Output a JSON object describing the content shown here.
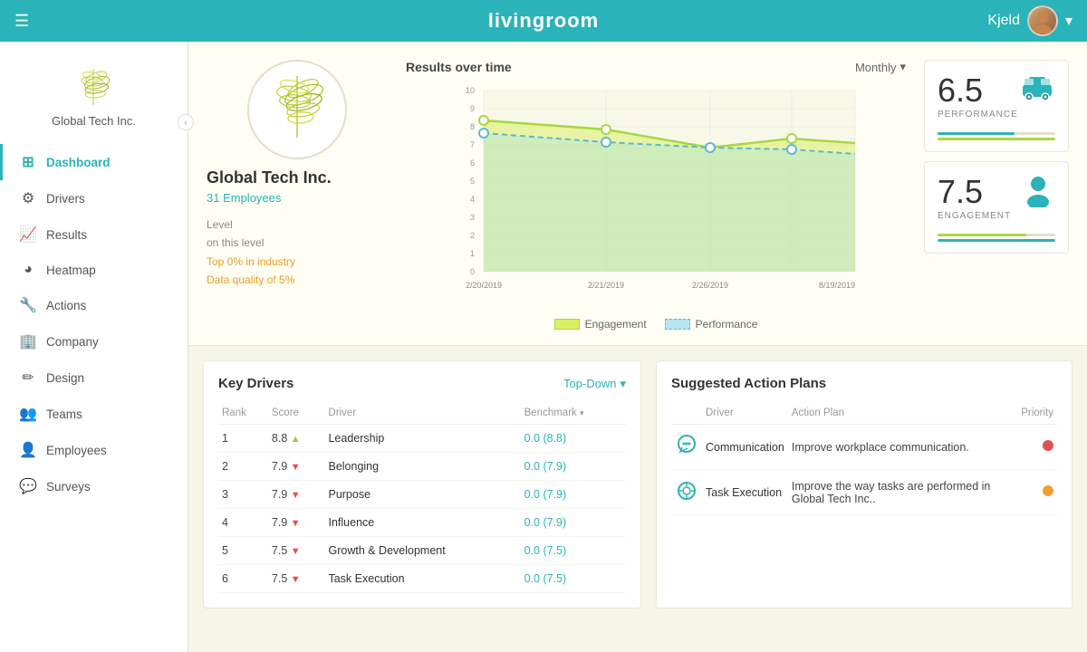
{
  "app": {
    "title": "livingroom"
  },
  "topbar": {
    "user_name": "Kjeld",
    "dropdown_arrow": "▾"
  },
  "sidebar": {
    "company_name": "Global Tech Inc.",
    "collapse_icon": "‹",
    "nav_items": [
      {
        "id": "dashboard",
        "label": "Dashboard",
        "icon": "⊞",
        "active": true
      },
      {
        "id": "drivers",
        "label": "Drivers",
        "icon": "⚙",
        "active": false
      },
      {
        "id": "results",
        "label": "Results",
        "icon": "📈",
        "active": false
      },
      {
        "id": "heatmap",
        "label": "Heatmap",
        "icon": "◕",
        "active": false
      },
      {
        "id": "actions",
        "label": "Actions",
        "icon": "🔧",
        "active": false
      },
      {
        "id": "company",
        "label": "Company",
        "icon": "🏢",
        "active": false
      },
      {
        "id": "design",
        "label": "Design",
        "icon": "👤",
        "active": false
      },
      {
        "id": "teams",
        "label": "Teams",
        "icon": "👥",
        "active": false
      },
      {
        "id": "employees",
        "label": "Employees",
        "icon": "👤",
        "active": false
      },
      {
        "id": "surveys",
        "label": "Surveys",
        "icon": "💬",
        "active": false
      }
    ]
  },
  "company_info": {
    "name": "Global Tech Inc.",
    "employees": "31 Employees",
    "level_label": "Level",
    "on_this_level": "on this level",
    "top_industry": "Top 0% in industry",
    "data_quality": "Data quality of 5%"
  },
  "chart": {
    "title_plain": "Results ",
    "title_bold": "over time",
    "period_selector": "Monthly",
    "legend_engagement": "Engagement",
    "legend_performance": "Performance",
    "x_labels": [
      "2/20/2019",
      "2/21/2019",
      "2/26/2019",
      "8/19/2019"
    ],
    "y_labels": [
      "0",
      "1",
      "2",
      "3",
      "4",
      "5",
      "6",
      "7",
      "8",
      "9",
      "10"
    ]
  },
  "scores": {
    "performance": {
      "value": "6.5",
      "label": "PERFORMANCE",
      "bar_color": "#2ab3b8",
      "bar_width": "65%"
    },
    "engagement": {
      "value": "7.5",
      "label": "ENGAGEMENT",
      "bar_color": "#a8d840",
      "bar_width": "75%"
    }
  },
  "key_drivers": {
    "title": "Key Drivers",
    "selector": "Top-Down",
    "col_rank": "Rank",
    "col_score": "Score",
    "col_driver": "Driver",
    "col_benchmark": "Benchmark",
    "rows": [
      {
        "rank": "1",
        "score": "8.8",
        "trend": "up",
        "driver": "Leadership",
        "benchmark": "0.0 (8.8)"
      },
      {
        "rank": "2",
        "score": "7.9",
        "trend": "down",
        "driver": "Belonging",
        "benchmark": "0.0 (7.9)"
      },
      {
        "rank": "3",
        "score": "7.9",
        "trend": "down",
        "driver": "Purpose",
        "benchmark": "0.0 (7.9)"
      },
      {
        "rank": "4",
        "score": "7.9",
        "trend": "down",
        "driver": "Influence",
        "benchmark": "0.0 (7.9)"
      },
      {
        "rank": "5",
        "score": "7.5",
        "trend": "down",
        "driver": "Growth & Development",
        "benchmark": "0.0 (7.5)"
      },
      {
        "rank": "6",
        "score": "7.5",
        "trend": "down",
        "driver": "Task Execution",
        "benchmark": "0.0 (7.5)"
      }
    ]
  },
  "action_plans": {
    "title": "Suggested Action Plans",
    "col_driver": "Driver",
    "col_action": "Action Plan",
    "col_priority": "Priority",
    "rows": [
      {
        "driver": "Communication",
        "driver_icon": "💬",
        "action": "Improve workplace communication.",
        "priority": "red"
      },
      {
        "driver": "Task Execution",
        "driver_icon": "⚙",
        "action": "Improve the way tasks are performed in Global Tech Inc..",
        "priority": "orange"
      }
    ]
  }
}
